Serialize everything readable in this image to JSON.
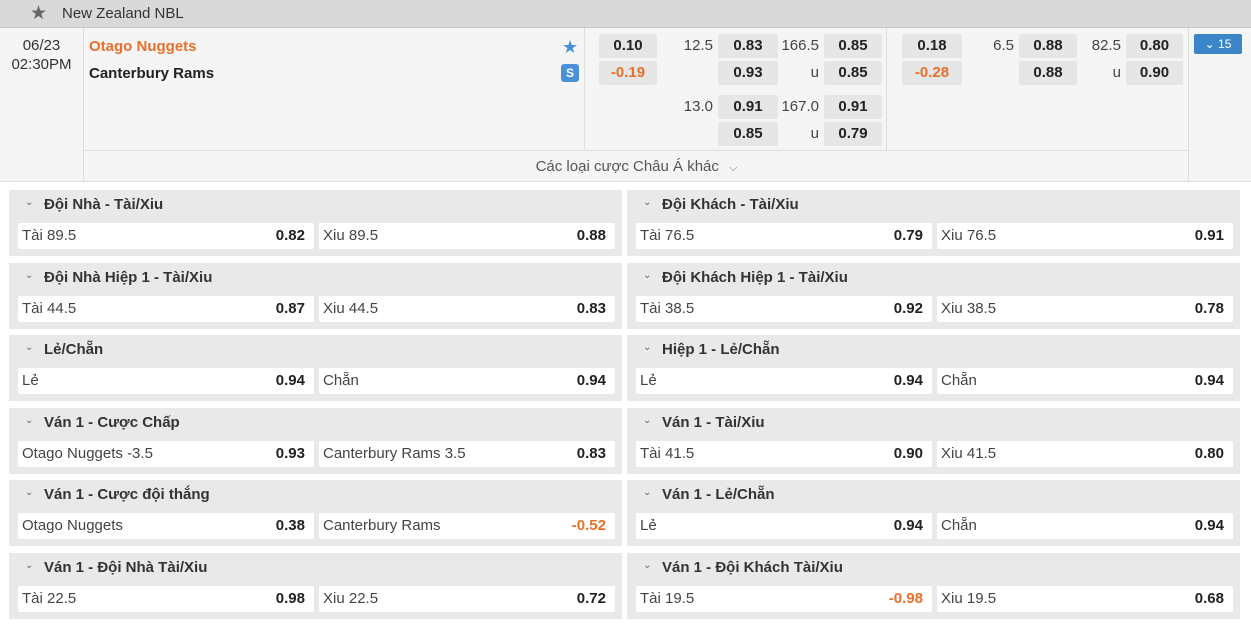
{
  "league": {
    "name": "New Zealand NBL",
    "star_icon": "star-icon"
  },
  "match": {
    "date": "06/23",
    "time": "02:30PM",
    "home": "Otago Nuggets",
    "away": "Canterbury Rams",
    "more_count": "15",
    "more_types": "Các loại cược Châu Á khác",
    "odds": {
      "ft_hdp": [
        {
          "home": "0.10",
          "away": "-0.19"
        }
      ],
      "ft_ou": [
        {
          "line": "12.5",
          "home": "0.83",
          "away": "0.93"
        },
        {
          "line": "13.0",
          "home": "0.91",
          "away": "0.85"
        }
      ],
      "ft_total": [
        {
          "line": "166.5",
          "under": "u",
          "over": "0.85",
          "u": "0.85"
        },
        {
          "line": "167.0",
          "under": "u",
          "over": "0.91",
          "u": "0.79"
        }
      ],
      "h1_hdp": {
        "home": "0.18",
        "away": "-0.28"
      },
      "h1_ou": {
        "line": "6.5",
        "home": "0.88",
        "away": "0.88"
      },
      "h1_total": {
        "line": "82.5",
        "under": "u",
        "over": "0.80",
        "u": "0.90"
      }
    }
  },
  "markets": [
    {
      "title": "Đội Nhà - Tài/Xiu",
      "a_label": "Tài 89.5",
      "a_val": "0.82",
      "b_label": "Xiu 89.5",
      "b_val": "0.88"
    },
    {
      "title": "Đội Khách - Tài/Xiu",
      "a_label": "Tài 76.5",
      "a_val": "0.79",
      "b_label": "Xiu 76.5",
      "b_val": "0.91"
    },
    {
      "title": "Đội Nhà Hiệp 1 - Tài/Xiu",
      "a_label": "Tài 44.5",
      "a_val": "0.87",
      "b_label": "Xiu 44.5",
      "b_val": "0.83"
    },
    {
      "title": "Đội Khách Hiệp 1 - Tài/Xiu",
      "a_label": "Tài 38.5",
      "a_val": "0.92",
      "b_label": "Xiu 38.5",
      "b_val": "0.78"
    },
    {
      "title": "Lẻ/Chẵn",
      "a_label": "Lẻ",
      "a_val": "0.94",
      "b_label": "Chẵn",
      "b_val": "0.94"
    },
    {
      "title": "Hiệp 1 - Lẻ/Chẵn",
      "a_label": "Lẻ",
      "a_val": "0.94",
      "b_label": "Chẵn",
      "b_val": "0.94"
    },
    {
      "title": "Ván 1 - Cược Chấp",
      "a_label": "Otago Nuggets -3.5",
      "a_val": "0.93",
      "b_label": "Canterbury Rams 3.5",
      "b_val": "0.83"
    },
    {
      "title": "Ván 1 - Tài/Xiu",
      "a_label": "Tài 41.5",
      "a_val": "0.90",
      "b_label": "Xiu 41.5",
      "b_val": "0.80"
    },
    {
      "title": "Ván 1 - Cược đội thắng",
      "a_label": "Otago Nuggets",
      "a_val": "0.38",
      "b_label": "Canterbury Rams",
      "b_val": "-0.52"
    },
    {
      "title": "Ván 1 - Lẻ/Chẵn",
      "a_label": "Lẻ",
      "a_val": "0.94",
      "b_label": "Chẵn",
      "b_val": "0.94"
    },
    {
      "title": "Ván 1 - Đội Nhà Tài/Xiu",
      "a_label": "Tài 22.5",
      "a_val": "0.98",
      "b_label": "Xiu 22.5",
      "b_val": "0.72"
    },
    {
      "title": "Ván 1 - Đội Khách Tài/Xiu",
      "a_label": "Tài 19.5",
      "a_val": "-0.98",
      "b_label": "Xiu 19.5",
      "b_val": "0.68"
    }
  ],
  "colors": {
    "accent_orange": "#e8702a",
    "accent_blue": "#3a86c8"
  }
}
